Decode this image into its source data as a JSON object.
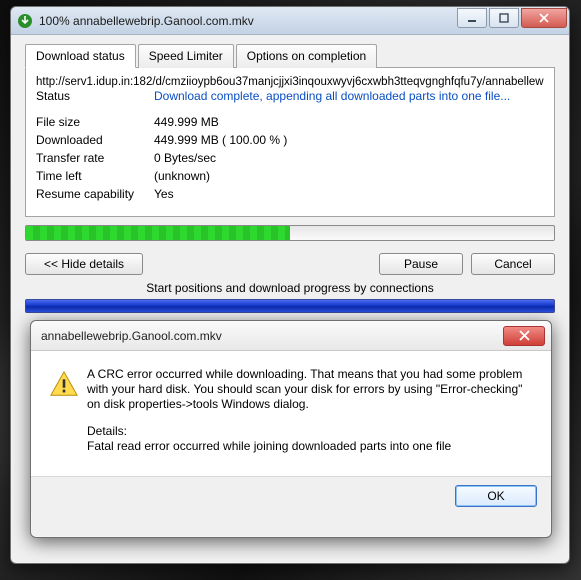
{
  "mainWindow": {
    "title": "100% annabellewebrip.Ganool.com.mkv",
    "tabs": {
      "status": "Download status",
      "limiter": "Speed Limiter",
      "completion": "Options on completion"
    },
    "url": "http://serv1.idup.in:182/d/cmziioypb6ou37manjcjjxi3inqouxwyvj6cxwbh3tteqvgnghfqfu7y/annabellew",
    "statusLabel": "Status",
    "statusValue": "Download complete, appending all downloaded parts into one file...",
    "rows": {
      "fileSizeLabel": "File size",
      "fileSizeValue": "449.999  MB",
      "downloadedLabel": "Downloaded",
      "downloadedValue": "449.999  MB   ( 100.00 % )",
      "transferLabel": "Transfer rate",
      "transferValue": "0  Bytes/sec",
      "timeLabel": "Time left",
      "timeValue": "(unknown)",
      "resumeLabel": "Resume capability",
      "resumeValue": "Yes"
    },
    "buttons": {
      "hide": "<<  Hide details",
      "pause": "Pause",
      "cancel": "Cancel"
    },
    "segmentCaption": "Start positions and download progress by connections"
  },
  "errorDialog": {
    "title": "annabellewebrip.Ganool.com.mkv",
    "message": "A CRC error occurred while downloading. That means that you had some problem with your hard disk. You should scan your disk for errors by using \"Error-checking\" on disk properties->tools Windows dialog.",
    "detailsLabel": "Details:",
    "detailsText": "Fatal read error occurred while joining downloaded parts into one file",
    "ok": "OK"
  }
}
